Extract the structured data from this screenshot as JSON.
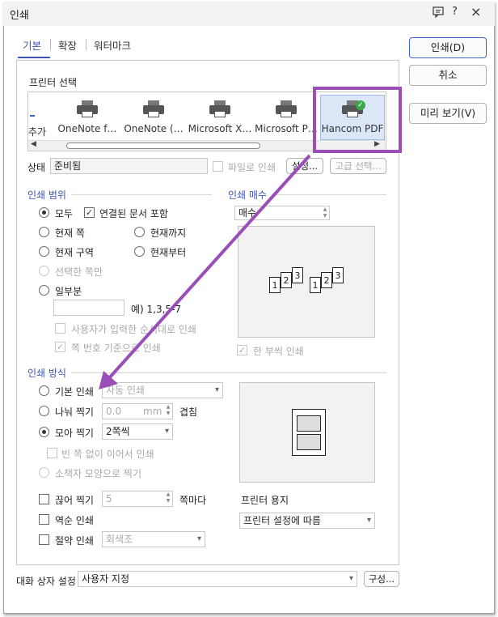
{
  "title": "인쇄",
  "titlebar_icons": {
    "help_chat": "chat-icon",
    "question": "?",
    "close": "×"
  },
  "tabs": [
    {
      "label": "기본"
    },
    {
      "label": "확장"
    },
    {
      "label": "워터마크"
    }
  ],
  "buttons": {
    "print": "인쇄(D)",
    "cancel": "취소",
    "preview": "미리 보기(V)"
  },
  "printer_select": {
    "label": "프린터 선택",
    "partial_first": "추가",
    "printers": [
      {
        "name": "OneNote f…"
      },
      {
        "name": "OneNote (…"
      },
      {
        "name": "Microsoft X…"
      },
      {
        "name": "Microsoft P…"
      },
      {
        "name": "Hancom PDF"
      }
    ],
    "selected": "Hancom PDF"
  },
  "status": {
    "label": "상태",
    "value": "준비됨",
    "file_print": "파일로 인쇄",
    "settings": "설정...",
    "advanced": "고급 선택..."
  },
  "print_range": {
    "title": "인쇄 범위",
    "all": "모두",
    "include_linked": "연결된 문서 포함",
    "current_page": "현재 쪽",
    "to_current": "현재까지",
    "current_section": "현재 구역",
    "from_current": "현재부터",
    "selected_pages": "선택한 쪽만",
    "some": "일부분",
    "example": "예) 1,3,5-7",
    "user_order": "사용자가 입력한 순서대로 인쇄",
    "page_number_based": "쪽 번호 기준으로 인쇄"
  },
  "copies": {
    "title": "인쇄 매수",
    "label": "매수",
    "one_by_one": "한 부씩 인쇄"
  },
  "print_method": {
    "title": "인쇄 방식",
    "basic": "기본 인쇄",
    "basic_option": "자동 인쇄",
    "split": "나눠 찍기",
    "split_value": "0.0",
    "split_unit": "mm",
    "overlap": "겹침",
    "collect": "모아 찍기",
    "collect_option": "2쪽씩",
    "no_blank": "빈 쪽 없이 이어서 인쇄",
    "booklet": "소책자 모양으로 찍기",
    "cut": "끊어 찍기",
    "cut_value": "5",
    "per_pages": "쪽마다",
    "reverse": "역순 인쇄",
    "save": "절약 인쇄",
    "save_option": "회색조"
  },
  "printer_paper": {
    "label": "프린터 용지",
    "value": "프린터 설정에 따름"
  },
  "dialog_settings": {
    "label": "대화 상자 설정",
    "value": "사용자 지정",
    "config": "구성..."
  },
  "accent_color": "#3c55b5",
  "highlight_color": "#9b4db8"
}
